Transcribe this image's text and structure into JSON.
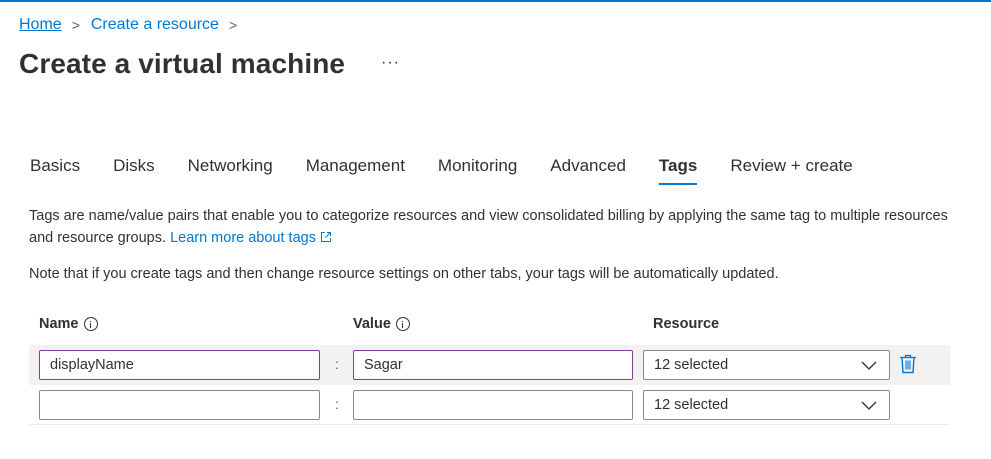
{
  "breadcrumb": {
    "home": "Home",
    "separator": ">",
    "current": "Create a resource"
  },
  "page": {
    "title": "Create a virtual machine",
    "more": "···"
  },
  "tabs": [
    {
      "label": "Basics"
    },
    {
      "label": "Disks"
    },
    {
      "label": "Networking"
    },
    {
      "label": "Management"
    },
    {
      "label": "Monitoring"
    },
    {
      "label": "Advanced"
    },
    {
      "label": "Tags",
      "active": true
    },
    {
      "label": "Review + create"
    }
  ],
  "description": {
    "text": "Tags are name/value pairs that enable you to categorize resources and view consolidated billing by applying the same tag to multiple resources and resource groups.",
    "link": "Learn more about tags"
  },
  "note": "Note that if you create tags and then change resource settings on other tabs, your tags will be automatically updated.",
  "table": {
    "headers": {
      "name": "Name",
      "value": "Value",
      "resource": "Resource"
    },
    "rows": [
      {
        "name": "displayName",
        "value": "Sagar",
        "resource": "12 selected",
        "separator": ":"
      },
      {
        "name": "",
        "value": "",
        "resource": "12 selected",
        "separator": ":"
      }
    ]
  },
  "colors": {
    "accent": "#0078d4",
    "text": "#323130",
    "focus_border": "#7f3f98",
    "delete_icon": "#0078d4"
  },
  "icons": {
    "external_link": "external-link-icon",
    "info": "info-icon",
    "chevron": "chevron-down-icon",
    "delete": "trash-icon"
  }
}
